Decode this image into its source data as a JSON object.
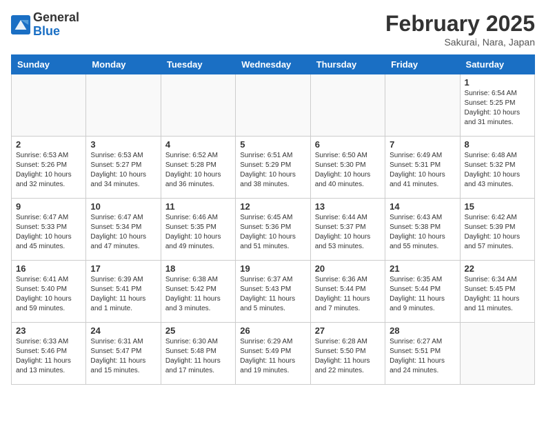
{
  "header": {
    "logo_general": "General",
    "logo_blue": "Blue",
    "month_title": "February 2025",
    "location": "Sakurai, Nara, Japan"
  },
  "weekdays": [
    "Sunday",
    "Monday",
    "Tuesday",
    "Wednesday",
    "Thursday",
    "Friday",
    "Saturday"
  ],
  "weeks": [
    [
      {
        "day": "",
        "info": ""
      },
      {
        "day": "",
        "info": ""
      },
      {
        "day": "",
        "info": ""
      },
      {
        "day": "",
        "info": ""
      },
      {
        "day": "",
        "info": ""
      },
      {
        "day": "",
        "info": ""
      },
      {
        "day": "1",
        "info": "Sunrise: 6:54 AM\nSunset: 5:25 PM\nDaylight: 10 hours and 31 minutes."
      }
    ],
    [
      {
        "day": "2",
        "info": "Sunrise: 6:53 AM\nSunset: 5:26 PM\nDaylight: 10 hours and 32 minutes."
      },
      {
        "day": "3",
        "info": "Sunrise: 6:53 AM\nSunset: 5:27 PM\nDaylight: 10 hours and 34 minutes."
      },
      {
        "day": "4",
        "info": "Sunrise: 6:52 AM\nSunset: 5:28 PM\nDaylight: 10 hours and 36 minutes."
      },
      {
        "day": "5",
        "info": "Sunrise: 6:51 AM\nSunset: 5:29 PM\nDaylight: 10 hours and 38 minutes."
      },
      {
        "day": "6",
        "info": "Sunrise: 6:50 AM\nSunset: 5:30 PM\nDaylight: 10 hours and 40 minutes."
      },
      {
        "day": "7",
        "info": "Sunrise: 6:49 AM\nSunset: 5:31 PM\nDaylight: 10 hours and 41 minutes."
      },
      {
        "day": "8",
        "info": "Sunrise: 6:48 AM\nSunset: 5:32 PM\nDaylight: 10 hours and 43 minutes."
      }
    ],
    [
      {
        "day": "9",
        "info": "Sunrise: 6:47 AM\nSunset: 5:33 PM\nDaylight: 10 hours and 45 minutes."
      },
      {
        "day": "10",
        "info": "Sunrise: 6:47 AM\nSunset: 5:34 PM\nDaylight: 10 hours and 47 minutes."
      },
      {
        "day": "11",
        "info": "Sunrise: 6:46 AM\nSunset: 5:35 PM\nDaylight: 10 hours and 49 minutes."
      },
      {
        "day": "12",
        "info": "Sunrise: 6:45 AM\nSunset: 5:36 PM\nDaylight: 10 hours and 51 minutes."
      },
      {
        "day": "13",
        "info": "Sunrise: 6:44 AM\nSunset: 5:37 PM\nDaylight: 10 hours and 53 minutes."
      },
      {
        "day": "14",
        "info": "Sunrise: 6:43 AM\nSunset: 5:38 PM\nDaylight: 10 hours and 55 minutes."
      },
      {
        "day": "15",
        "info": "Sunrise: 6:42 AM\nSunset: 5:39 PM\nDaylight: 10 hours and 57 minutes."
      }
    ],
    [
      {
        "day": "16",
        "info": "Sunrise: 6:41 AM\nSunset: 5:40 PM\nDaylight: 10 hours and 59 minutes."
      },
      {
        "day": "17",
        "info": "Sunrise: 6:39 AM\nSunset: 5:41 PM\nDaylight: 11 hours and 1 minute."
      },
      {
        "day": "18",
        "info": "Sunrise: 6:38 AM\nSunset: 5:42 PM\nDaylight: 11 hours and 3 minutes."
      },
      {
        "day": "19",
        "info": "Sunrise: 6:37 AM\nSunset: 5:43 PM\nDaylight: 11 hours and 5 minutes."
      },
      {
        "day": "20",
        "info": "Sunrise: 6:36 AM\nSunset: 5:44 PM\nDaylight: 11 hours and 7 minutes."
      },
      {
        "day": "21",
        "info": "Sunrise: 6:35 AM\nSunset: 5:44 PM\nDaylight: 11 hours and 9 minutes."
      },
      {
        "day": "22",
        "info": "Sunrise: 6:34 AM\nSunset: 5:45 PM\nDaylight: 11 hours and 11 minutes."
      }
    ],
    [
      {
        "day": "23",
        "info": "Sunrise: 6:33 AM\nSunset: 5:46 PM\nDaylight: 11 hours and 13 minutes."
      },
      {
        "day": "24",
        "info": "Sunrise: 6:31 AM\nSunset: 5:47 PM\nDaylight: 11 hours and 15 minutes."
      },
      {
        "day": "25",
        "info": "Sunrise: 6:30 AM\nSunset: 5:48 PM\nDaylight: 11 hours and 17 minutes."
      },
      {
        "day": "26",
        "info": "Sunrise: 6:29 AM\nSunset: 5:49 PM\nDaylight: 11 hours and 19 minutes."
      },
      {
        "day": "27",
        "info": "Sunrise: 6:28 AM\nSunset: 5:50 PM\nDaylight: 11 hours and 22 minutes."
      },
      {
        "day": "28",
        "info": "Sunrise: 6:27 AM\nSunset: 5:51 PM\nDaylight: 11 hours and 24 minutes."
      },
      {
        "day": "",
        "info": ""
      }
    ]
  ]
}
